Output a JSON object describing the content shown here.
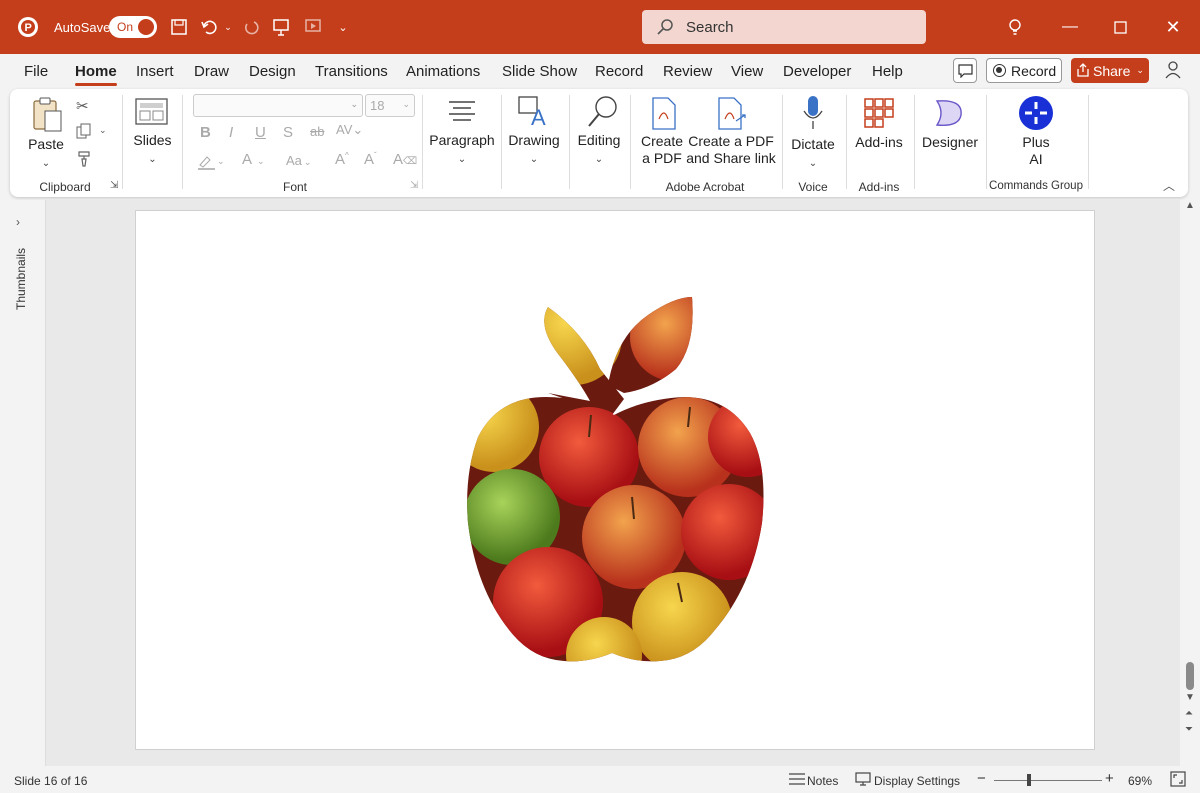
{
  "titlebar": {
    "autosave_label": "AutoSave",
    "toggle_state": "On",
    "search_placeholder": "Search"
  },
  "menu": {
    "tabs": [
      "File",
      "Home",
      "Insert",
      "Draw",
      "Design",
      "Transitions",
      "Animations",
      "Slide Show",
      "Record",
      "Review",
      "View",
      "Developer",
      "Help"
    ],
    "active": "Home",
    "record_button": "Record",
    "share_button": "Share"
  },
  "ribbon": {
    "clipboard": {
      "paste": "Paste",
      "label": "Clipboard"
    },
    "slides": {
      "label": "Slides"
    },
    "font": {
      "size": "18",
      "label": "Font"
    },
    "paragraph": {
      "label": "Paragraph"
    },
    "drawing": {
      "label": "Drawing"
    },
    "editing": {
      "label": "Editing"
    },
    "acrobat": {
      "create_pdf_1": "Create",
      "create_pdf_2": "a PDF",
      "share_pdf_1": "Create a PDF",
      "share_pdf_2": "and Share link",
      "label": "Adobe Acrobat"
    },
    "voice": {
      "dictate": "Dictate",
      "label": "Voice"
    },
    "addins": {
      "addins": "Add-ins",
      "label": "Add-ins"
    },
    "designer": {
      "label": "Designer"
    },
    "commands": {
      "plus_1": "Plus",
      "plus_2": "AI",
      "label": "Commands Group"
    }
  },
  "side": {
    "thumbnails": "Thumbnails"
  },
  "status": {
    "slide_info": "Slide 16 of 16",
    "notes": "Notes",
    "display_settings": "Display Settings",
    "zoom": "69%"
  },
  "colors": {
    "accent": "#c43e1c"
  }
}
